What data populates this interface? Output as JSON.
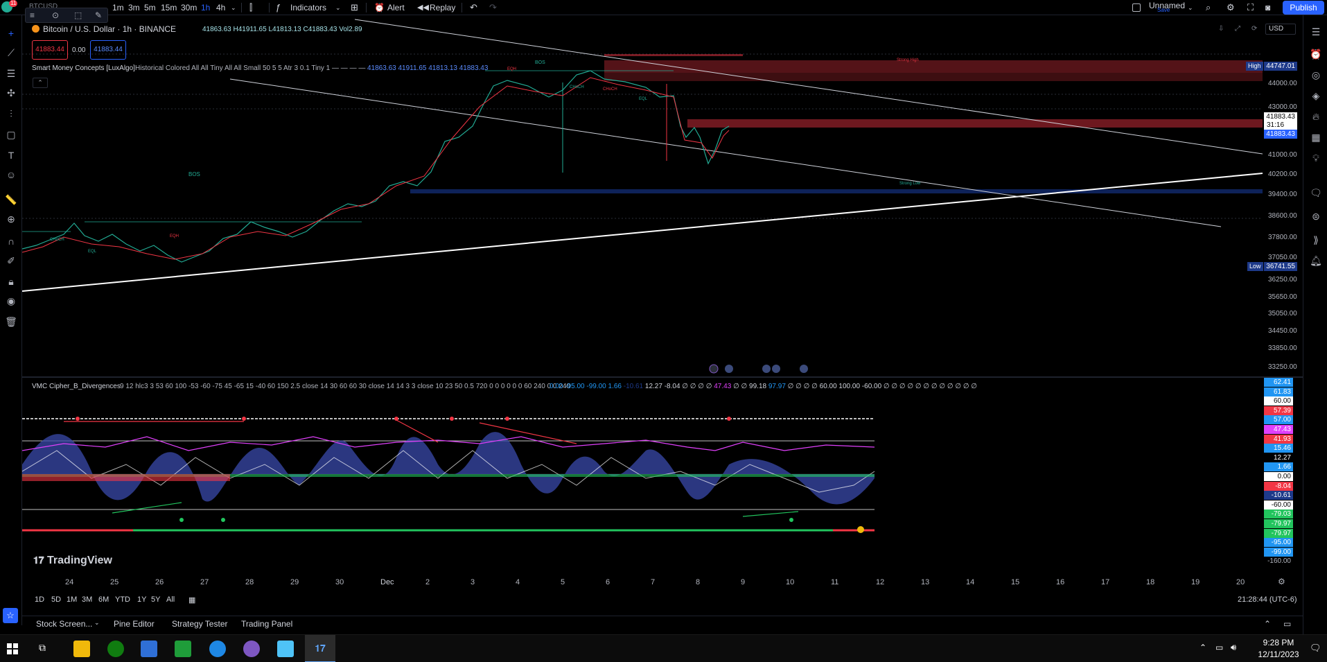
{
  "toolbar": {
    "symbol": "BTCUSD",
    "intervals": [
      "1m",
      "3m",
      "5m",
      "15m",
      "30m",
      "1h",
      "4h"
    ],
    "active_interval": "1h",
    "indicators_label": "Indicators",
    "alert_label": "Alert",
    "replay_label": "Replay",
    "layout_name": "Unnamed",
    "layout_status": "Save",
    "publish_label": "Publish",
    "notification_count": "11"
  },
  "legend": {
    "title": "Bitcoin / U.S. Dollar · 1h · BINANCE",
    "ohlc": "41863.63 H41911.65 L41813.13 C41883.43 Vol2.89",
    "sell_price": "41883.44",
    "spread": "0.00",
    "buy_price": "41883.44",
    "indicator": "Smart Money Concepts [LuxAlgo]",
    "indicator_params": "Historical Colored All All Tiny All All Small 50 5 5 Atr 3 0.1 Tiny 1 — — — —",
    "indicator_values": "41863.63  41911.65  41813.13  41883.43"
  },
  "currency": "USD",
  "price_axis": {
    "labels": [
      "44000.00",
      "43000.00",
      "41000.00",
      "40200.00",
      "39400.00",
      "38600.00",
      "37800.00",
      "37050.00",
      "36250.00",
      "35650.00",
      "35050.00",
      "34450.00",
      "33850.00",
      "33250.00"
    ],
    "high_label": "High",
    "high_value": "44747.01",
    "low_label": "Low",
    "low_value": "36741.55",
    "current_price": "41883.43",
    "countdown": "31:16",
    "current_price_2": "41883.43"
  },
  "chart_labels": {
    "bos": "BOS",
    "choch": "CHoCH",
    "eql": "EQL",
    "eqh": "EQH",
    "strong_high": "Strong High",
    "strong_low": "Strong Low"
  },
  "oscillator": {
    "title": "VMC Cipher_B_Divergences",
    "params": "9 12 hlc3 3 53 60 100 -53 -60 -75 45 -65 15 -40 60 150 2.5 close 14 30 60 60 30 close 14 14 3 3 close 10 23 50 0.5 720 0 0 0 0 0 0 60 240 0 0 240",
    "values_a": "0.00  -95.00  -99.00  1.66",
    "values_dim": "-10.61",
    "values_b": "12.27  -8.04  ∅ ∅ ∅ ∅",
    "values_c": "47.43",
    "values_d": "∅ ∅ 99.18",
    "values_e": "97.97",
    "values_f": "∅ ∅ ∅ ∅ 60.00  100.00  -60.00  ∅ ∅ ∅ ∅ ∅ ∅ ∅ ∅ ∅ ∅ ∅ ∅",
    "tags": [
      {
        "v": "62.41",
        "c": "#2196f3"
      },
      {
        "v": "61.83",
        "c": "#2196f3"
      },
      {
        "v": "60.00",
        "c": "#ffffff",
        "t": "#000"
      },
      {
        "v": "57.39",
        "c": "#f23645"
      },
      {
        "v": "57.00",
        "c": "#2196f3"
      },
      {
        "v": "47.43",
        "c": "#e040fb"
      },
      {
        "v": "41.93",
        "c": "#f23645"
      },
      {
        "v": "15.46",
        "c": "#2196f3"
      },
      {
        "v": "12.27",
        "c": "#000000"
      },
      {
        "v": "1.66",
        "c": "#2196f3"
      },
      {
        "v": "0.00",
        "c": "#ffffff",
        "t": "#000"
      },
      {
        "v": "-8.04",
        "c": "#f23645"
      },
      {
        "v": "-10.61",
        "c": "#1e3a8a"
      },
      {
        "v": "-60.00",
        "c": "#ffffff",
        "t": "#000"
      },
      {
        "v": "-79.03",
        "c": "#22c55e"
      },
      {
        "v": "-79.97",
        "c": "#22c55e"
      },
      {
        "v": "-79.97",
        "c": "#22c55e"
      },
      {
        "v": "-95.00",
        "c": "#2196f3"
      },
      {
        "v": "-99.00",
        "c": "#2196f3"
      },
      {
        "v": "-160.00",
        "c": "transparent",
        "t": "#b2b5be"
      }
    ]
  },
  "watermark": "TradingView",
  "time_axis": [
    "24",
    "25",
    "26",
    "27",
    "28",
    "29",
    "30",
    "Dec",
    "2",
    "3",
    "4",
    "5",
    "6",
    "7",
    "8",
    "9",
    "10",
    "11",
    "12",
    "13",
    "14",
    "15",
    "16",
    "17",
    "18",
    "19",
    "20"
  ],
  "ranges": [
    "1D",
    "5D",
    "1M",
    "3M",
    "6M",
    "YTD",
    "1Y",
    "5Y",
    "All"
  ],
  "clock": "21:28:44 (UTC-6)",
  "bottom_tabs": [
    "Stock Screen...",
    "Pine Editor",
    "Strategy Tester",
    "Trading Panel"
  ],
  "taskbar": {
    "time": "9:28 PM",
    "date": "12/11/2023"
  }
}
